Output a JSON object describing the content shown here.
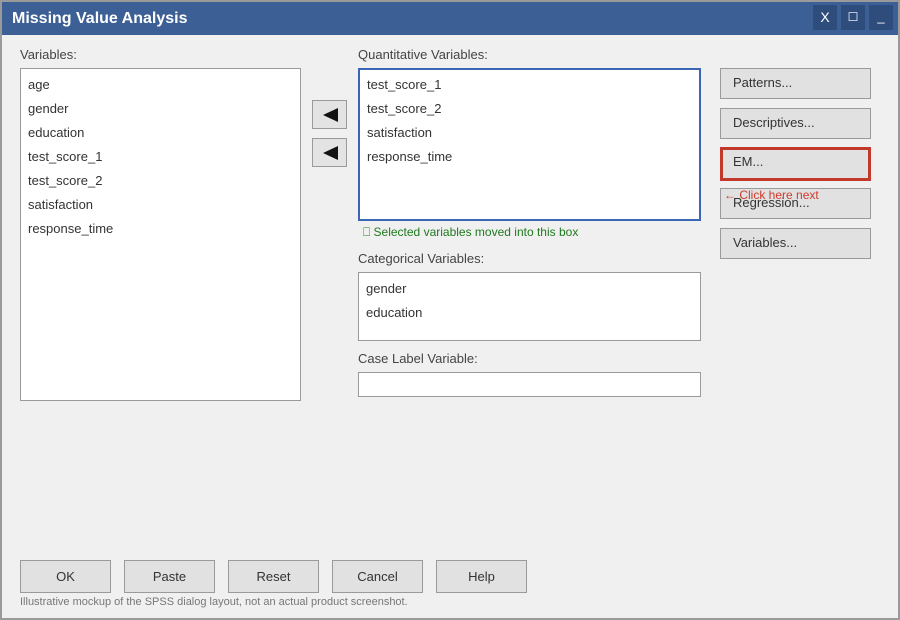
{
  "window": {
    "title": "Missing Value Analysis",
    "controls": {
      "close": "X",
      "maximize": "☐",
      "minimize": "_"
    }
  },
  "variables": {
    "label": "Variables:",
    "items": [
      "age",
      "gender",
      "education",
      "test_score_1",
      "test_score_2",
      "satisfaction",
      "response_time"
    ]
  },
  "quantitative": {
    "label": "Quantitative Variables:",
    "items": [
      "test_score_1",
      "test_score_2",
      "satisfaction",
      "response_time"
    ],
    "hint": "⎕ Selected variables moved into this box"
  },
  "categorical": {
    "label": "Categorical Variables:",
    "items": [
      "gender",
      "education"
    ]
  },
  "case_label": {
    "label": "Case Label Variable:",
    "value": ""
  },
  "side_buttons": {
    "patterns": "Patterns...",
    "descriptives": "Descriptives...",
    "em": "EM...",
    "regression": "Regression...",
    "variables": "Variables..."
  },
  "annotation": {
    "click_next": "← Click here next"
  },
  "bottom_buttons": {
    "ok": "OK",
    "paste": "Paste",
    "reset": "Reset",
    "cancel": "Cancel",
    "help": "Help"
  },
  "footnote": "Illustrative mockup of the SPSS dialog layout, not an actual product screenshot.",
  "colors": {
    "titlebar": "#3c5f95",
    "focus_border": "#3a66b5",
    "highlight_border": "#c0392b",
    "hint_green": "#1e7a1e",
    "hint_red": "#d03a2a"
  }
}
